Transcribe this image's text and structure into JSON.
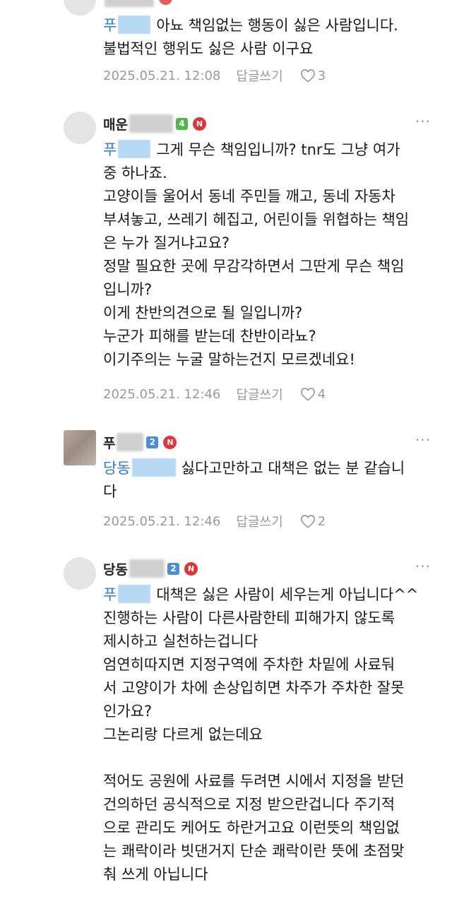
{
  "comments": [
    {
      "author": "",
      "mention": "푸",
      "lines": [
        "아뇨 책임없는 행동이 싫은 사람입니다.",
        "불법적인 행위도 싫은 사람 이구요"
      ],
      "timestamp": "2025.05.21. 12:08",
      "reply_label": "답글쓰기",
      "likes": "3"
    },
    {
      "author": "매운",
      "level": "4",
      "new_badge": "N",
      "more": "···",
      "mention": "푸",
      "lines": [
        "그게 무슨 책임입니까? tnr도 그냥 여가",
        "중 하나죠.",
        "고양이들 울어서 동네 주민들 깨고, 동네 자동차",
        "부셔놓고, 쓰레기 헤집고, 어린이들 위협하는 책임",
        "은 누가 질거냐고요?",
        "정말 필요한 곳에 무감각하면서 그딴게 무슨 책임",
        "입니까?",
        "이게 찬반의견으로 될 일입니까?",
        "누군가 피해를 받는데 찬반이라뇨?",
        "이기주의는 누굴 말하는건지 모르겠네요!"
      ],
      "timestamp": "2025.05.21. 12:46",
      "reply_label": "답글쓰기",
      "likes": "4"
    },
    {
      "author": "푸",
      "level": "2",
      "new_badge": "N",
      "more": "···",
      "mention": "당동",
      "lines": [
        "싫다고만하고 대책은 없는 분 같습니",
        "다"
      ],
      "timestamp": "2025.05.21. 12:46",
      "reply_label": "답글쓰기",
      "likes": "2"
    },
    {
      "author": "당동",
      "level": "2",
      "new_badge": "N",
      "more": "···",
      "mention": "푸",
      "lines": [
        "대책은 싫은 사람이 세우는게 아닙니다^^",
        "진행하는 사람이 다른사람한테 피해가지 않도록",
        "제시하고 실천하는겁니다",
        "엄연히따지면 지정구역에 주차한 차밑에 사료둬",
        "서 고양이가 차에 손상입히면 차주가 주차한 잘못",
        "인가요?",
        "그논리랑 다르게 없는데요",
        "",
        "적어도 공원에 사료를 두려면 시에서 지정을 받던",
        "건의하던 공식적으로 지정 받으란겁니다 주기적",
        "으로 관리도 케어도 하란거고요 이런뜻의 책임없",
        "는 쾌락이라 빗댄거지 단순 쾌락이란 뜻에 초점맞",
        "춰 쓰게 아닙니다"
      ]
    }
  ],
  "colors": {
    "mention": "#2f7bd8",
    "meta": "#9a9a9a",
    "new_badge": "#e0343a",
    "level_green": "#50b848",
    "level_blue": "#4a8cd8"
  }
}
